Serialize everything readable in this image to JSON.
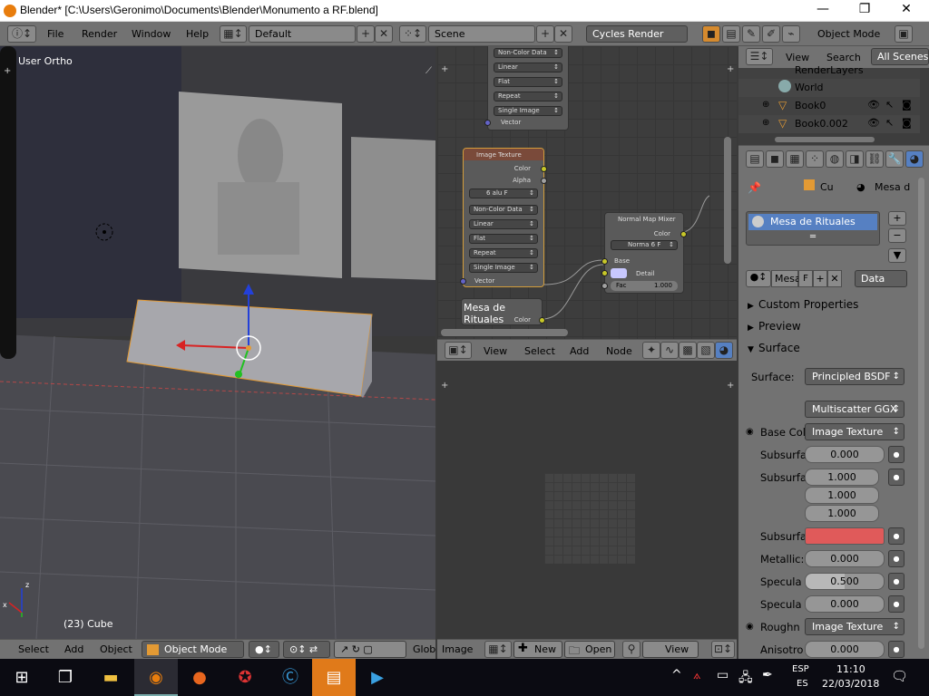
{
  "window": {
    "title": "Blender* [C:\\Users\\Geronimo\\Documents\\Blender\\Monumento a RF.blend]",
    "minimize": "—",
    "maximize": "❐",
    "close": "✕"
  },
  "infobar": {
    "menus": [
      "File",
      "Render",
      "Window",
      "Help"
    ],
    "screen_layout": "Default",
    "scene": "Scene",
    "render_engine": "Cycles Render",
    "mode_label": "Object Mode"
  },
  "viewport": {
    "view_label": "User Ortho",
    "object_info": "(23) Cube",
    "axis_z": "z",
    "axis_x": "x",
    "menus": [
      "Select",
      "Add",
      "Object"
    ],
    "mode": "Object Mode",
    "orientation": "Glob"
  },
  "node_editor": {
    "top_node": {
      "options": [
        "Non-Color Data",
        "Linear",
        "Flat",
        "Repeat",
        "Single Image"
      ],
      "vector": "Vector"
    },
    "image_texture": {
      "title": "Image Texture",
      "out_color": "Color",
      "out_alpha": "Alpha",
      "image": "6 alu",
      "f": "F",
      "options": [
        "Non-Color Data",
        "Linear",
        "Flat",
        "Repeat",
        "Single Image"
      ],
      "vector": "Vector"
    },
    "normal_map_mixer": {
      "title": "Normal Map Mixer",
      "out_color": "Color",
      "image": "Norma",
      "num": "6",
      "f": "F",
      "base": "Base",
      "detail": "Detail",
      "fac_label": "Fac",
      "fac_value": "1.000"
    },
    "material_label": {
      "title": "Mesa de Rituales",
      "out": "Color"
    },
    "menus": [
      "View",
      "Select",
      "Add",
      "Node"
    ]
  },
  "image_editor": {
    "menus": [
      "Image"
    ],
    "new_label": "New",
    "open_label": "Open",
    "view_label": "View"
  },
  "outliner": {
    "view": "View",
    "search": "Search",
    "scene_filter": "All Scenes",
    "items": [
      {
        "label": "RenderLayers"
      },
      {
        "label": "World"
      },
      {
        "label": "Book0"
      },
      {
        "label": "Book0.002"
      }
    ]
  },
  "properties": {
    "breadcrumb": [
      "Cu",
      "Mesa d"
    ],
    "material_slot": "Mesa de Rituales",
    "material_name": "Mesa",
    "f": "F",
    "link": "Data",
    "panels": [
      "Custom Properties",
      "Preview",
      "Surface"
    ],
    "surface": {
      "label": "Surface:",
      "shader": "Principled BSDF",
      "distribution": "Multiscatter GGX",
      "base_color_label": "Base Col",
      "base_color_value": "Image Texture",
      "subsurface_label": "Subsurfa",
      "subsurface_value": "0.000",
      "subsurface_radius_label": "Subsurfa",
      "radius": [
        "1.000",
        "1.000",
        "1.000"
      ],
      "subsurface_color_label": "Subsurfa",
      "subsurface_color": "#e05a5a",
      "metallic_label": "Metallic:",
      "metallic": "0.000",
      "specular_label": "Specula",
      "specular": "0.500",
      "specular_tint_label": "Specula",
      "specular_tint": "0.000",
      "roughness_label": "Roughn",
      "roughness_value": "Image Texture",
      "anisotropic_label": "Anisotro",
      "anisotropic": "0.000"
    }
  },
  "taskbar": {
    "lang_top": "ESP",
    "lang_bottom": "ES",
    "time": "11:10",
    "date": "22/03/2018"
  }
}
